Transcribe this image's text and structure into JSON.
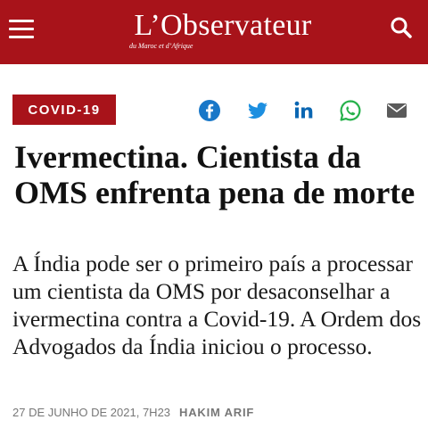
{
  "header": {
    "logo_name": "L’Observateur",
    "logo_tagline": "du Maroc et d’Afrique",
    "background_color": "#a8131a",
    "menu_icon": "hamburger-menu-icon",
    "search_icon": "search-icon"
  },
  "article": {
    "category": "COVID-19",
    "share_icons": [
      "facebook-icon",
      "twitter-icon",
      "linkedin-icon",
      "whatsapp-icon",
      "email-icon"
    ],
    "headline": "Ivermectina. Cientista da OMS enfrenta pena de morte",
    "lede": "A Índia pode ser o primeiro país a processar um cientista da OMS por desaconselhar a ivermectina contra a Covid-19. A Ordem dos Advogados da Índia iniciou o processo.",
    "date": "27 DE JUNHO DE 2021, 7H23",
    "author": "HAKIM ARIF"
  }
}
